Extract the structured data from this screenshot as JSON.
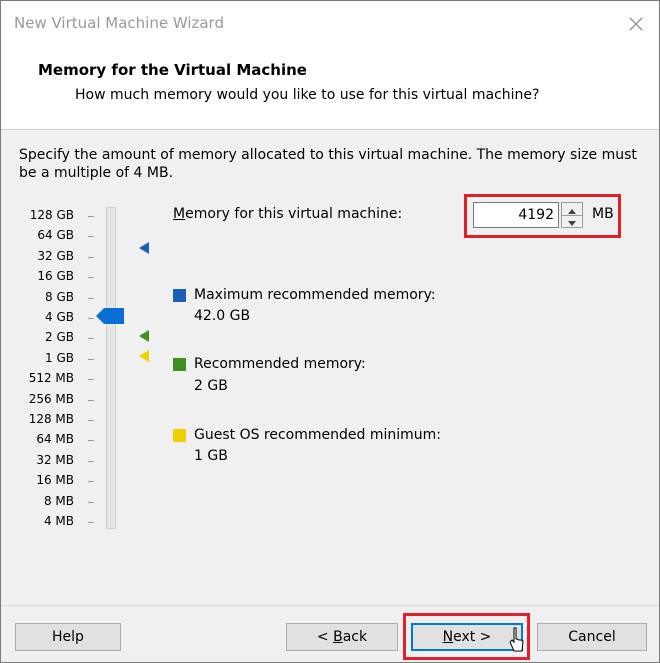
{
  "window": {
    "title": "New Virtual Machine Wizard"
  },
  "header": {
    "title": "Memory for the Virtual Machine",
    "subtitle": "How much memory would you like to use for this virtual machine?"
  },
  "description": "Specify the amount of memory allocated to this virtual machine. The memory size must be a multiple of 4 MB.",
  "scale": {
    "labels": [
      "128 GB",
      "64 GB",
      "32 GB",
      "16 GB",
      "8 GB",
      "4 GB",
      "2 GB",
      "1 GB",
      "512 MB",
      "256 MB",
      "128 MB",
      "64 MB",
      "32 MB",
      "16 MB",
      "8 MB",
      "4 MB"
    ]
  },
  "memory": {
    "label_prefix": "",
    "label_mnemonic": "M",
    "label_rest": "emory for this virtual machine:",
    "value": "4192",
    "unit": "MB"
  },
  "legend": {
    "max": {
      "title": "Maximum recommended memory:",
      "value": "42.0 GB",
      "color": "#1a5fb4"
    },
    "recommended": {
      "title": "Recommended memory:",
      "value": "2 GB",
      "color": "#3f8f1f"
    },
    "guest_min": {
      "title": "Guest OS recommended minimum:",
      "value": "1 GB",
      "color": "#f0d000"
    }
  },
  "buttons": {
    "help": "Help",
    "back_prefix": "< ",
    "back_mnemonic": "B",
    "back_rest": "ack",
    "next_mnemonic": "N",
    "next_rest": "ext >",
    "cancel": "Cancel"
  },
  "colors": {
    "slider_thumb": "#0a6fd0",
    "highlight": "#e0202a"
  }
}
